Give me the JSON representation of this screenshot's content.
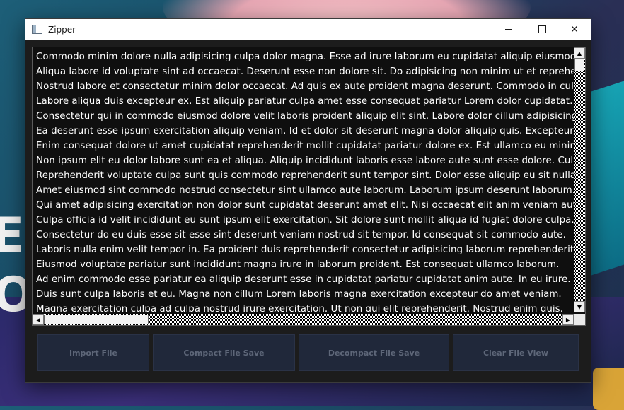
{
  "window": {
    "title": "Zipper"
  },
  "editor": {
    "lines": [
      "Commodo minim dolore nulla adipisicing culpa dolor magna. Esse ad irure laborum eu cupidatat aliquip eiusmod.",
      "Aliqua labore id voluptate sint ad occaecat. Deserunt esse non dolore sit. Do adipisicing non minim ut et reprehenderit.",
      "Nostrud labore et consectetur minim dolor occaecat. Ad quis ex aute proident magna deserunt. Commodo in culpa.",
      "Labore aliqua duis excepteur ex. Est aliquip pariatur culpa amet esse consequat pariatur Lorem dolor cupidatat.",
      "Consectetur qui in commodo eiusmod dolore velit laboris proident aliquip elit sint. Labore dolor cillum adipisicing.",
      "Ea deserunt esse ipsum exercitation aliquip veniam. Id et dolor sit deserunt magna dolor aliquip quis. Excepteur.",
      "Enim consequat dolore ut amet cupidatat reprehenderit mollit cupidatat pariatur dolore ex. Est ullamco eu minim.",
      "Non ipsum elit eu dolor labore sunt ea et aliqua. Aliquip incididunt laboris esse labore aute sunt esse dolore. Culpa.",
      "Reprehenderit voluptate culpa sunt quis commodo reprehenderit sunt tempor sint. Dolor esse aliquip eu sit nulla.",
      "Amet eiusmod sint commodo nostrud consectetur sint ullamco aute laborum. Laborum ipsum deserunt laborum.",
      "Qui amet adipisicing exercitation non dolor sunt cupidatat deserunt amet elit. Nisi occaecat elit anim veniam aute.",
      "Culpa officia id velit incididunt eu sunt ipsum elit exercitation. Sit dolore sunt mollit aliqua id fugiat dolore culpa.",
      "Consectetur do eu duis esse sit esse sint deserunt veniam nostrud sit tempor. Id consequat sit commodo aute.",
      "Laboris nulla enim velit tempor in. Ea proident duis reprehenderit consectetur adipisicing laborum reprehenderit.",
      "Eiusmod voluptate pariatur sunt incididunt magna irure in laborum proident. Est consequat ullamco laborum.",
      "Ad enim commodo esse pariatur ea aliquip deserunt esse in cupidatat pariatur cupidatat anim aute. In eu irure.",
      "Duis sunt culpa laboris et eu. Magna non cillum Lorem laboris magna exercitation excepteur do amet veniam.",
      "Magna exercitation culpa ad culpa nostrud irure exercitation. Ut non qui elit reprehenderit. Nostrud enim quis."
    ]
  },
  "actions": {
    "import": "Import File",
    "compact": "Compact File  Save",
    "decompact": "Decompact File  Save",
    "clear": "Clear File View"
  },
  "wallpaper": {
    "glyph_a": "E",
    "glyph_b": "O"
  }
}
